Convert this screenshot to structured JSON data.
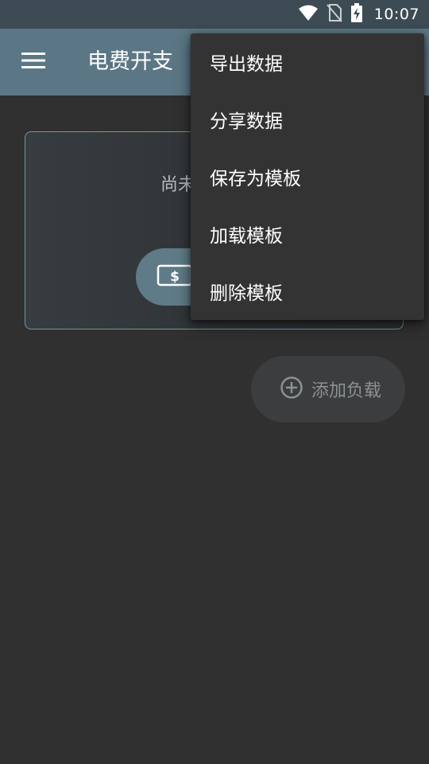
{
  "status_bar": {
    "time": "10:07",
    "icons": [
      "wifi-icon",
      "no-sim-icon",
      "battery-charging-icon"
    ]
  },
  "app_bar": {
    "menu_icon": "hamburger-menu-icon",
    "title": "电费开支"
  },
  "empty_card": {
    "message": "尚未",
    "button_icon": "dollar-bill-icon"
  },
  "fab": {
    "icon": "add-circle-icon",
    "label": "添加负载"
  },
  "overflow_menu": {
    "items": [
      {
        "label": "导出数据"
      },
      {
        "label": "分享数据"
      },
      {
        "label": "保存为模板"
      },
      {
        "label": "加载模板"
      },
      {
        "label": "删除模板"
      }
    ]
  },
  "colors": {
    "status_bar": "#3d4b54",
    "app_bar": "#5b7684",
    "background": "#303030",
    "menu_background": "#333333",
    "card_border": "#6e9a9c",
    "card_button": "#607b88"
  }
}
